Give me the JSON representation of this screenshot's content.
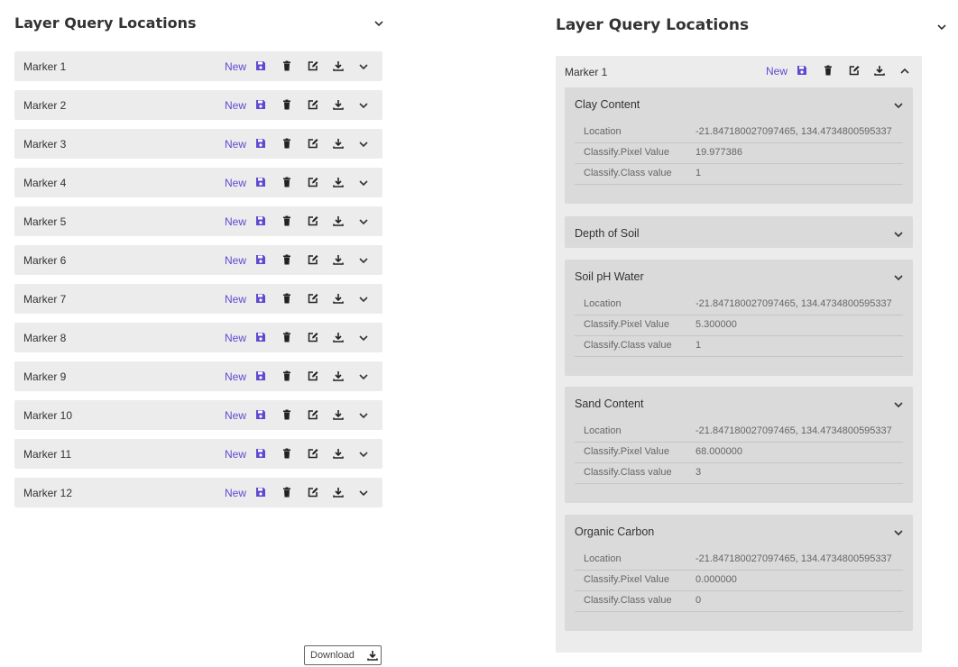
{
  "left_panel": {
    "title": "Layer Query Locations",
    "markers": [
      {
        "name": "Marker 1",
        "new_label": "New"
      },
      {
        "name": "Marker 2",
        "new_label": "New"
      },
      {
        "name": "Marker 3",
        "new_label": "New"
      },
      {
        "name": "Marker 4",
        "new_label": "New"
      },
      {
        "name": "Marker 5",
        "new_label": "New"
      },
      {
        "name": "Marker 6",
        "new_label": "New"
      },
      {
        "name": "Marker 7",
        "new_label": "New"
      },
      {
        "name": "Marker 8",
        "new_label": "New"
      },
      {
        "name": "Marker 9",
        "new_label": "New"
      },
      {
        "name": "Marker 10",
        "new_label": "New"
      },
      {
        "name": "Marker 11",
        "new_label": "New"
      },
      {
        "name": "Marker 12",
        "new_label": "New"
      }
    ],
    "download_label": "Download"
  },
  "right_panel": {
    "title": "Layer Query Locations",
    "marker": {
      "name": "Marker 1",
      "new_label": "New"
    },
    "sections": [
      {
        "title": "Clay Content",
        "expanded": true,
        "rows": [
          {
            "key": "Location",
            "value": "-21.847180027097465, 134.4734800595337"
          },
          {
            "key": "Classify.Pixel Value",
            "value": "19.977386"
          },
          {
            "key": "Classify.Class value",
            "value": "1"
          }
        ]
      },
      {
        "title": "Depth of Soil",
        "expanded": false,
        "rows": []
      },
      {
        "title": "Soil pH Water",
        "expanded": true,
        "rows": [
          {
            "key": "Location",
            "value": "-21.847180027097465, 134.4734800595337"
          },
          {
            "key": "Classify.Pixel Value",
            "value": "5.300000"
          },
          {
            "key": "Classify.Class value",
            "value": "1"
          }
        ]
      },
      {
        "title": "Sand Content",
        "expanded": true,
        "rows": [
          {
            "key": "Location",
            "value": "-21.847180027097465, 134.4734800595337"
          },
          {
            "key": "Classify.Pixel Value",
            "value": "68.000000"
          },
          {
            "key": "Classify.Class value",
            "value": "3"
          }
        ]
      },
      {
        "title": "Organic Carbon",
        "expanded": true,
        "rows": [
          {
            "key": "Location",
            "value": "-21.847180027097465, 134.4734800595337"
          },
          {
            "key": "Classify.Pixel Value",
            "value": "0.000000"
          },
          {
            "key": "Classify.Class value",
            "value": "0"
          }
        ]
      }
    ]
  },
  "icons": {
    "save": "floppy-disk-icon",
    "delete": "trash-icon",
    "edit": "edit-icon",
    "download": "download-icon",
    "expand": "chevron-down-icon",
    "collapse": "chevron-up-icon"
  },
  "colors": {
    "accent": "#5e4ad1",
    "row_bg": "#ececec",
    "section_bg": "#dadada"
  }
}
